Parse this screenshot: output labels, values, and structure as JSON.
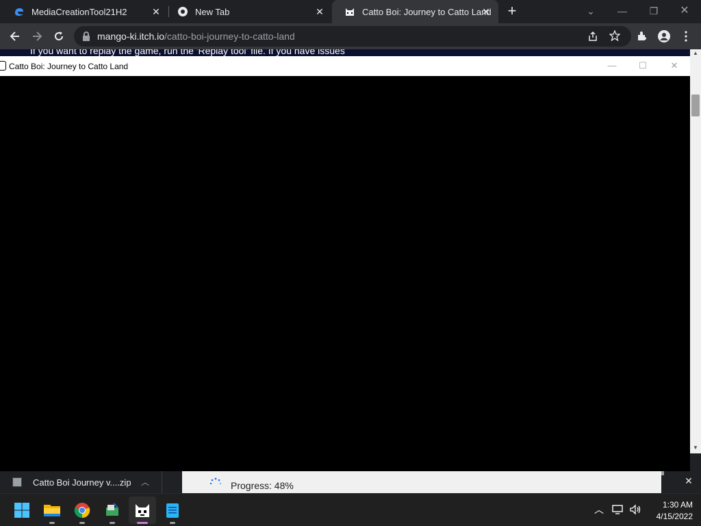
{
  "browser": {
    "tabs": [
      {
        "label": "MediaCreationTool21H2",
        "icon": "edge-icon",
        "active": false
      },
      {
        "label": "New Tab",
        "icon": "chrome-icon",
        "active": false
      },
      {
        "label": "Catto Boi: Journey to Catto Land",
        "icon": "catto-icon",
        "active": true
      }
    ],
    "close_glyph": "✕",
    "new_tab_glyph": "+",
    "url_host": "mango-ki.itch.io",
    "url_path": "/catto-boi-journey-to-catto-land"
  },
  "webpage": {
    "partial_text": "If you want to replay the game, run the 'Replay tool' file. If you have issues"
  },
  "game_window": {
    "title": "Catto Boi: Journey to Catto Land",
    "canvas_color": "#000000"
  },
  "download_bar": {
    "filename": "Catto Boi Journey v....zip",
    "progress_label": "Progress: 48%",
    "progress_fraction": 0.48
  },
  "taskbar": {
    "apps": [
      "windows-start",
      "file-explorer",
      "chrome",
      "installer",
      "catto-boi-game",
      "notepad"
    ],
    "clock_time": "1:30 AM",
    "clock_date": "4/15/2022"
  },
  "colors": {
    "browser_dark": "#202124",
    "toolbar": "#35363a",
    "accent_windows": "#0078d4"
  }
}
